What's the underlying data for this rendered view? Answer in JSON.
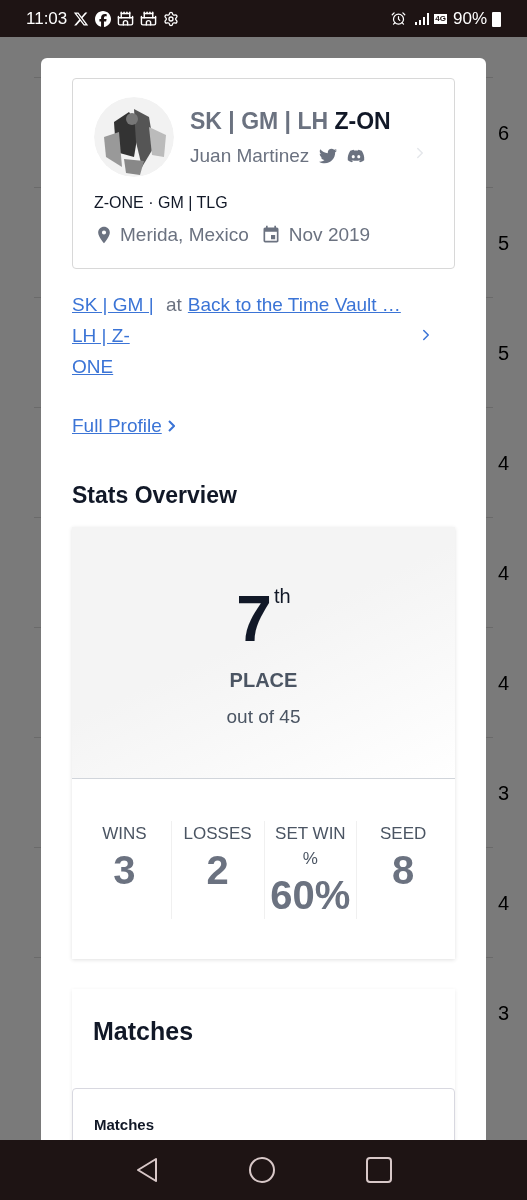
{
  "status_bar": {
    "time": "11:03",
    "network": "4G",
    "battery": "90%"
  },
  "background_rows": [
    {
      "value": "6"
    },
    {
      "value": "5"
    },
    {
      "value": "5"
    },
    {
      "value": "4"
    },
    {
      "value": "4"
    },
    {
      "value": "4"
    },
    {
      "value": "3"
    },
    {
      "value": "4"
    },
    {
      "value": "3"
    }
  ],
  "profile": {
    "tag": "SK | GM | LH",
    "gamertag": "Z-ON",
    "real_name": "Juan Martinez",
    "team": "Z-ONE · GM | TLG",
    "location": "Merida, Mexico",
    "joined": "Nov 2019"
  },
  "entrant_link": {
    "player": "SK | GM | LH | Z-ONE",
    "at": "at",
    "event": "Back to the Time Vault …"
  },
  "full_profile": "Full Profile",
  "stats_title": "Stats Overview",
  "placement": {
    "rank": "7",
    "suffix": "th",
    "label": "PLACE",
    "total": "out of 45"
  },
  "stats": [
    {
      "label": "WINS",
      "value": "3"
    },
    {
      "label": "LOSSES",
      "value": "2"
    },
    {
      "label": "SET WIN %",
      "value": "60%"
    },
    {
      "label": "SEED",
      "value": "8"
    }
  ],
  "matches": {
    "title": "Matches",
    "subtitle": "Matches"
  }
}
